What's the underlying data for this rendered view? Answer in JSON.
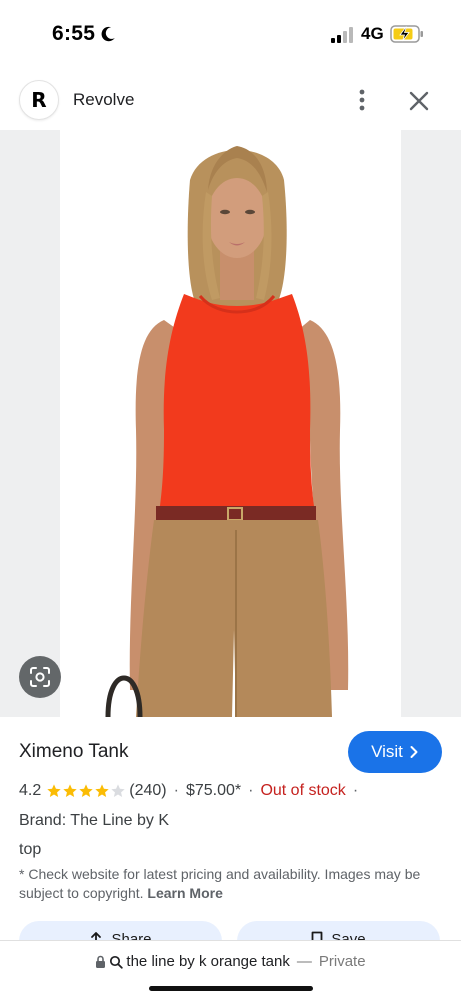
{
  "status_bar": {
    "time": "6:55",
    "network": "4G",
    "icons": [
      "moon-icon",
      "signal-icon",
      "battery-charging-icon"
    ]
  },
  "header": {
    "logo_letter": "R",
    "site_name": "Revolve",
    "icons": [
      "more-vert-icon",
      "close-icon"
    ]
  },
  "image": {
    "lens_icon": "google-lens-icon",
    "colors": {
      "top": "#f23a1d",
      "pants": "#b4895a",
      "belt": "#7a2a24",
      "skin": "#c88f6c",
      "hair": "#b8915c"
    }
  },
  "product": {
    "title": "Ximeno Tank",
    "visit_label": "Visit",
    "rating": "4.2",
    "stars_filled": 4,
    "stars_total": 5,
    "review_count": "(240)",
    "price": "$75.00*",
    "stock_status": "Out of stock",
    "brand": "Brand: The Line by K",
    "category": "top",
    "disclaimer": "* Check website for latest pricing and availability. Images may be subject to copyright.",
    "learn_more": "Learn More"
  },
  "actions": {
    "share_label": "Share",
    "save_label": "Save"
  },
  "address_bar": {
    "query": "the line by k orange tank",
    "separator": "—",
    "mode": "Private"
  },
  "colors": {
    "accent": "#1a73e8",
    "out_of_stock": "#c5221f",
    "star": "#fbbc04"
  }
}
